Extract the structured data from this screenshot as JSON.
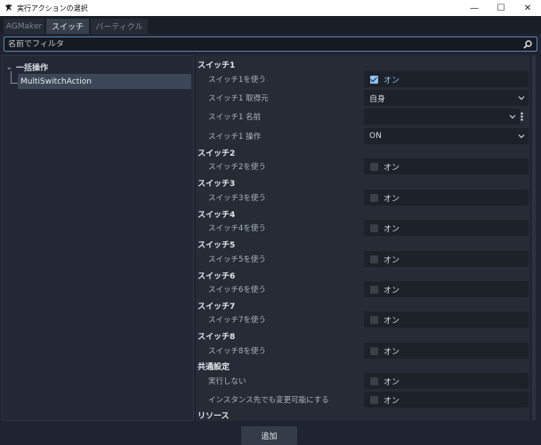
{
  "window": {
    "title": "実行アクションの選択",
    "minimize": "—",
    "maximize": "☐",
    "close": "✕"
  },
  "tabs": [
    {
      "label": "AGMaker"
    },
    {
      "label": "スイッチ"
    },
    {
      "label": "パーティクル"
    }
  ],
  "filter": {
    "placeholder": "名前でフィルタ",
    "value": ""
  },
  "tree": {
    "root_label": "一括操作",
    "child_label": "MultiSwitchAction"
  },
  "inspector": {
    "sections": [
      {
        "title": "スイッチ1"
      },
      {
        "title": "スイッチ2"
      },
      {
        "title": "スイッチ3"
      },
      {
        "title": "スイッチ4"
      },
      {
        "title": "スイッチ5"
      },
      {
        "title": "スイッチ6"
      },
      {
        "title": "スイッチ7"
      },
      {
        "title": "スイッチ8"
      },
      {
        "title": "共通設定"
      },
      {
        "title": "リソース"
      }
    ],
    "switch1": {
      "use_label": "スイッチ1を使う",
      "use_value": "オン",
      "use_checked": true,
      "source_label": "スイッチ1 取得元",
      "source_value": "自身",
      "name_label": "スイッチ1 名前",
      "name_value": "",
      "op_label": "スイッチ1 操作",
      "op_value": "ON"
    },
    "switches": [
      {
        "label": "スイッチ2を使う",
        "value": "オン",
        "checked": false
      },
      {
        "label": "スイッチ3を使う",
        "value": "オン",
        "checked": false
      },
      {
        "label": "スイッチ4を使う",
        "value": "オン",
        "checked": false
      },
      {
        "label": "スイッチ5を使う",
        "value": "オン",
        "checked": false
      },
      {
        "label": "スイッチ6を使う",
        "value": "オン",
        "checked": false
      },
      {
        "label": "スイッチ7を使う",
        "value": "オン",
        "checked": false
      },
      {
        "label": "スイッチ8を使う",
        "value": "オン",
        "checked": false
      }
    ],
    "common": [
      {
        "label": "実行しない",
        "value": "オン",
        "checked": false
      },
      {
        "label": "インスタンス先でも変更可能にする",
        "value": "オン",
        "checked": false
      }
    ]
  },
  "add_button": "追加",
  "colors": {
    "accent": "#8ec1f0",
    "background": "#1f2430",
    "panel": "#262b36",
    "selection": "#3b4757"
  },
  "icons": [
    "app-icon",
    "search-icon",
    "chevron-down-icon",
    "kebab-menu-icon",
    "tree-collapse-icon",
    "checkbox-icon"
  ]
}
